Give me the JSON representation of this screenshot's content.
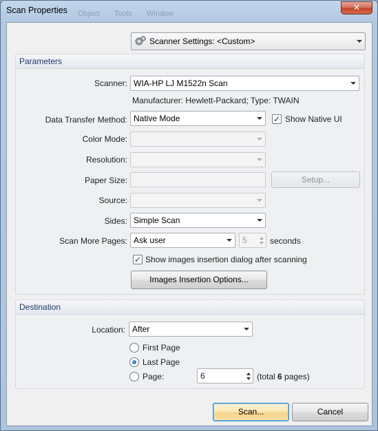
{
  "window": {
    "title": "Scan Properties",
    "ghost_menu": [
      "Object",
      "Tools",
      "Window"
    ],
    "close_glyph": "✕"
  },
  "top": {
    "settings_combo": "Scanner Settings:  <Custom>",
    "settings_icon": "gear-icon"
  },
  "parameters": {
    "header": "Parameters",
    "scanner_label": "Scanner:",
    "scanner_value": "WIA-HP LJ M1522n Scan",
    "manufacturer_text": "Manufacturer: Hewlett-Packard; Type: TWAIN",
    "transfer_label": "Data Transfer Method:",
    "transfer_value": "Native Mode",
    "native_ui_label": "Show Native UI",
    "native_ui_checked": true,
    "color_mode_label": "Color Mode:",
    "resolution_label": "Resolution:",
    "paper_size_label": "Paper Size:",
    "setup_button": "Setup...",
    "source_label": "Source:",
    "sides_label": "Sides:",
    "sides_value": "Simple Scan",
    "scan_more_label": "Scan More Pages:",
    "scan_more_value": "Ask user",
    "seconds_value": "5",
    "seconds_label": "seconds",
    "insertion_dialog_label": "Show images insertion dialog after scanning",
    "insertion_dialog_checked": true,
    "insertion_options_button": "Images Insertion Options..."
  },
  "destination": {
    "header": "Destination",
    "location_label": "Location:",
    "location_value": "After",
    "first_page_label": "First Page",
    "last_page_label": "Last Page",
    "page_label": "Page:",
    "page_value": "6",
    "total_prefix": "(total ",
    "total_count": "6",
    "total_suffix": " pages)",
    "selected": "Last Page"
  },
  "footer": {
    "scan_button": "Scan...",
    "cancel_button": "Cancel"
  },
  "colors": {
    "frame": "#b3c9e2",
    "group_header_text": "#1e3a6e",
    "close_red": "#c2442a",
    "default_button_border": "#3b8cc2"
  }
}
